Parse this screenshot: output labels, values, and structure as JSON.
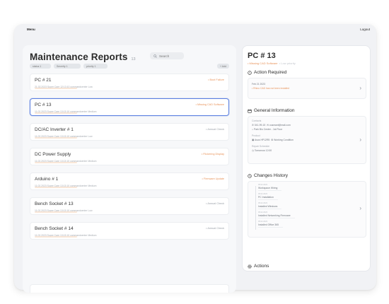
{
  "topbar": {
    "menu": "Menu",
    "logout": "Logout"
  },
  "list": {
    "title": "Maintenance Reports",
    "count": "13",
    "search_placeholder": "Search",
    "filters": [
      "status 1",
      "Severity 1",
      "priority 1"
    ],
    "add_filter": "+ Add"
  },
  "reports": [
    {
      "title": "PC # 21",
      "tag": "Boot Failure",
      "tag_color": "#e8935a",
      "meta": "21.02.2023   Super Care   12:13:10   commandcenter   Low",
      "selected": false
    },
    {
      "title": "PC # 13",
      "tag": "Missing CAD Software",
      "tag_color": "#e8935a",
      "meta": "11.02.2023   Super Care   13:13:10   commandcenter   Medium",
      "selected": true
    },
    {
      "title": "DC/AC Inverter # 1",
      "tag": "Annual Check",
      "tag_color": "#9aa0a8",
      "meta": "11.02.2023   Super Care   13:13:10   commandcenter   Low",
      "selected": false
    },
    {
      "title": "DC Power Supply",
      "tag": "Flickering Display",
      "tag_color": "#e8935a",
      "meta": "11.02.2023   Super Care   13:13:10   commandcenter   Medium",
      "selected": false
    },
    {
      "title": "Arduino # 1",
      "tag": "Firmware Update",
      "tag_color": "#e8935a",
      "meta": "11.02.2023   Super Care   13:13:10   commandcenter   Medium",
      "selected": false
    },
    {
      "title": "Bench Socket # 13",
      "tag": "Annual Check",
      "tag_color": "#9aa0a8",
      "meta": "11.02.2023   Super Care   13:13:10   commandcenter   Low",
      "selected": false
    },
    {
      "title": "Bench Socket # 14",
      "tag": "Annual Check",
      "tag_color": "#9aa0a8",
      "meta": "11.02.2023   Super Care   13:13:10   commandcenter   Medium",
      "selected": false
    }
  ],
  "detail": {
    "title": "PC # 13",
    "sub_warn": "Missing CAD Software",
    "sub_rest": "Low priority",
    "action": {
      "heading": "Action Required",
      "date": "Feb 21 2023",
      "note": "Rhino CAD has not been installed"
    },
    "general": {
      "heading": "General Information",
      "contacts_label": "Contacts",
      "phone": "041-99-15",
      "email": "cusmant@mail.com",
      "location": "Park Bio Center - 1st Floor",
      "product_label": "Product",
      "product": "Asus HP12R5",
      "condition": "Working Condition",
      "repair_label": "Repair Schedule",
      "repair": "Tomorrow 12:00"
    },
    "history": {
      "heading": "Changes History",
      "items": [
        {
          "date": "05.02.2023",
          "label": "Workspace Wiring"
        },
        {
          "date": "05.02.2023",
          "label": "PC Installation"
        },
        {
          "date": "05.02.2023",
          "label": "Installed Windows"
        },
        {
          "date": "05.02.2023",
          "label": "Installed Networking Firmware"
        },
        {
          "date": "05.02.2023",
          "label": "Installed Office 365"
        }
      ]
    },
    "actions_heading": "Actions"
  }
}
